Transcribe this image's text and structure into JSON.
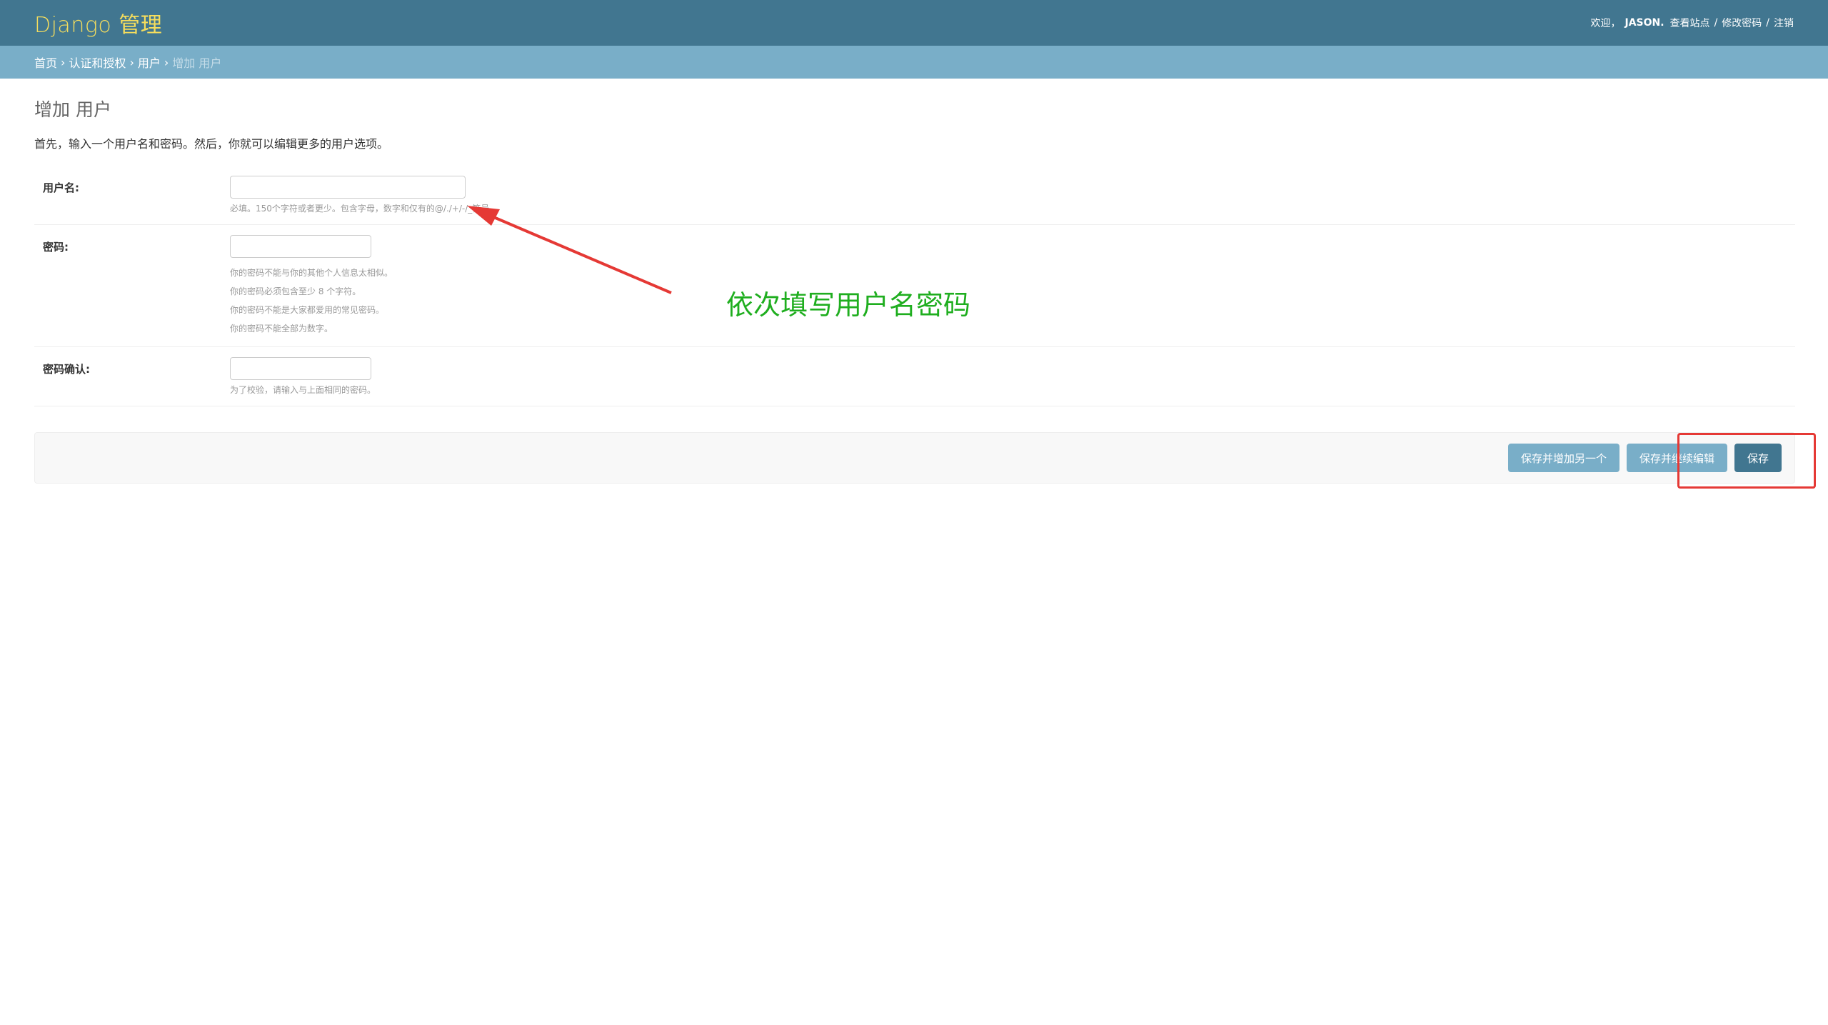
{
  "header": {
    "branding": "Django 管理",
    "welcome": "欢迎，",
    "username": "JASON",
    "username_suffix": ".",
    "view_site": "查看站点",
    "change_password": "修改密码",
    "logout": "注销",
    "separator": "/"
  },
  "breadcrumbs": {
    "home": "首页",
    "app": "认证和授权",
    "model": "用户",
    "current": "增加 用户",
    "separator": "›"
  },
  "page": {
    "title": "增加 用户",
    "intro": "首先，输入一个用户名和密码。然后，你就可以编辑更多的用户选项。"
  },
  "form": {
    "username": {
      "label": "用户名:",
      "value": "",
      "help": "必填。150个字符或者更少。包含字母，数字和仅有的@/./+/-/_符号。"
    },
    "password1": {
      "label": "密码:",
      "value": "",
      "help": [
        "你的密码不能与你的其他个人信息太相似。",
        "你的密码必须包含至少 8 个字符。",
        "你的密码不能是大家都爱用的常见密码。",
        "你的密码不能全部为数字。"
      ]
    },
    "password2": {
      "label": "密码确认:",
      "value": "",
      "help": "为了校验，请输入与上面相同的密码。"
    }
  },
  "buttons": {
    "save_add_another": "保存并增加另一个",
    "save_continue": "保存并继续编辑",
    "save": "保存"
  },
  "annotation": {
    "text": "依次填写用户名密码",
    "color": "#1fae1f",
    "arrow_color": "#e53935"
  },
  "colors": {
    "header_bg": "#417690",
    "branding": "#f5dd5d",
    "breadcrumbs_bg": "#79aec8",
    "button_light": "#79aec8",
    "button_dark": "#417690"
  }
}
